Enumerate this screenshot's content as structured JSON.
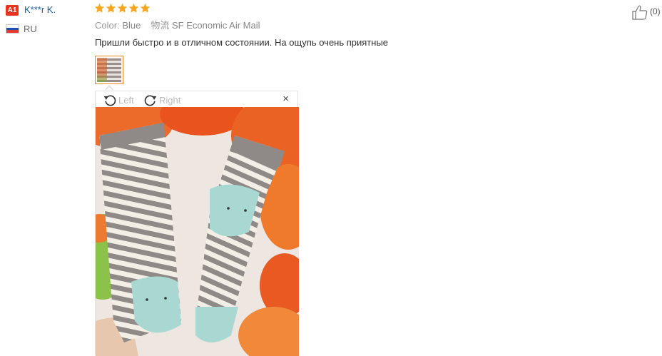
{
  "reviewer": {
    "badge": "A1",
    "name": "K***r K.",
    "country": "RU",
    "flag_colors": [
      "#ffffff",
      "#1c4eb8",
      "#e23a2c"
    ]
  },
  "rating": {
    "stars": 5,
    "max": 5,
    "color": "#f5a623"
  },
  "attributes": {
    "color_label": "Color:",
    "color_value": "Blue",
    "shipping_label": "物流",
    "shipping_value": "SF Economic Air Mail"
  },
  "review_text": "Пришли быстро и в отличном состоянии. На ощупь очень приятные",
  "viewer": {
    "rotate_left_label": "Left",
    "rotate_right_label": "Right",
    "close_label": "×"
  },
  "like": {
    "count_text": "(0)"
  },
  "colors": {
    "accent": "#f08a1e",
    "link": "#1a5fad",
    "badge": "#e8341c"
  }
}
